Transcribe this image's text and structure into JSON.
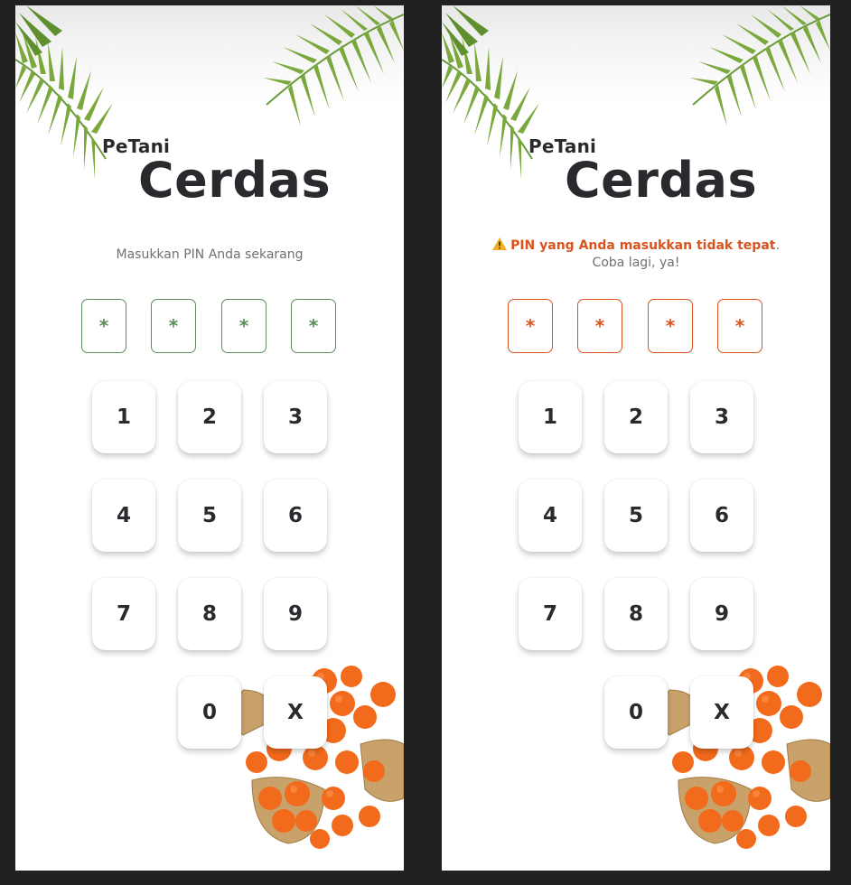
{
  "brand": {
    "small": "PeTani",
    "large": "Cerdas"
  },
  "left_screen": {
    "prompt": "Masukkan PIN Anda sekarang",
    "pin": [
      "*",
      "*",
      "*",
      "*"
    ]
  },
  "right_screen": {
    "error_strong": "PIN yang Anda masukkan tidak tepat",
    "error_rest": ". Coba lagi, ya!",
    "pin": [
      "*",
      "*",
      "*",
      "*"
    ]
  },
  "keypad": {
    "k1": "1",
    "k2": "2",
    "k3": "3",
    "k4": "4",
    "k5": "5",
    "k6": "6",
    "k7": "7",
    "k8": "8",
    "k9": "9",
    "k0": "0",
    "clear": "X"
  },
  "colors": {
    "accent_green": "#5b8c5a",
    "error_orange": "#d9531e",
    "text_dark": "#2a2a2e",
    "text_muted": "#707070",
    "frame": "#212121"
  },
  "icons": {
    "warning": "warning-icon"
  }
}
